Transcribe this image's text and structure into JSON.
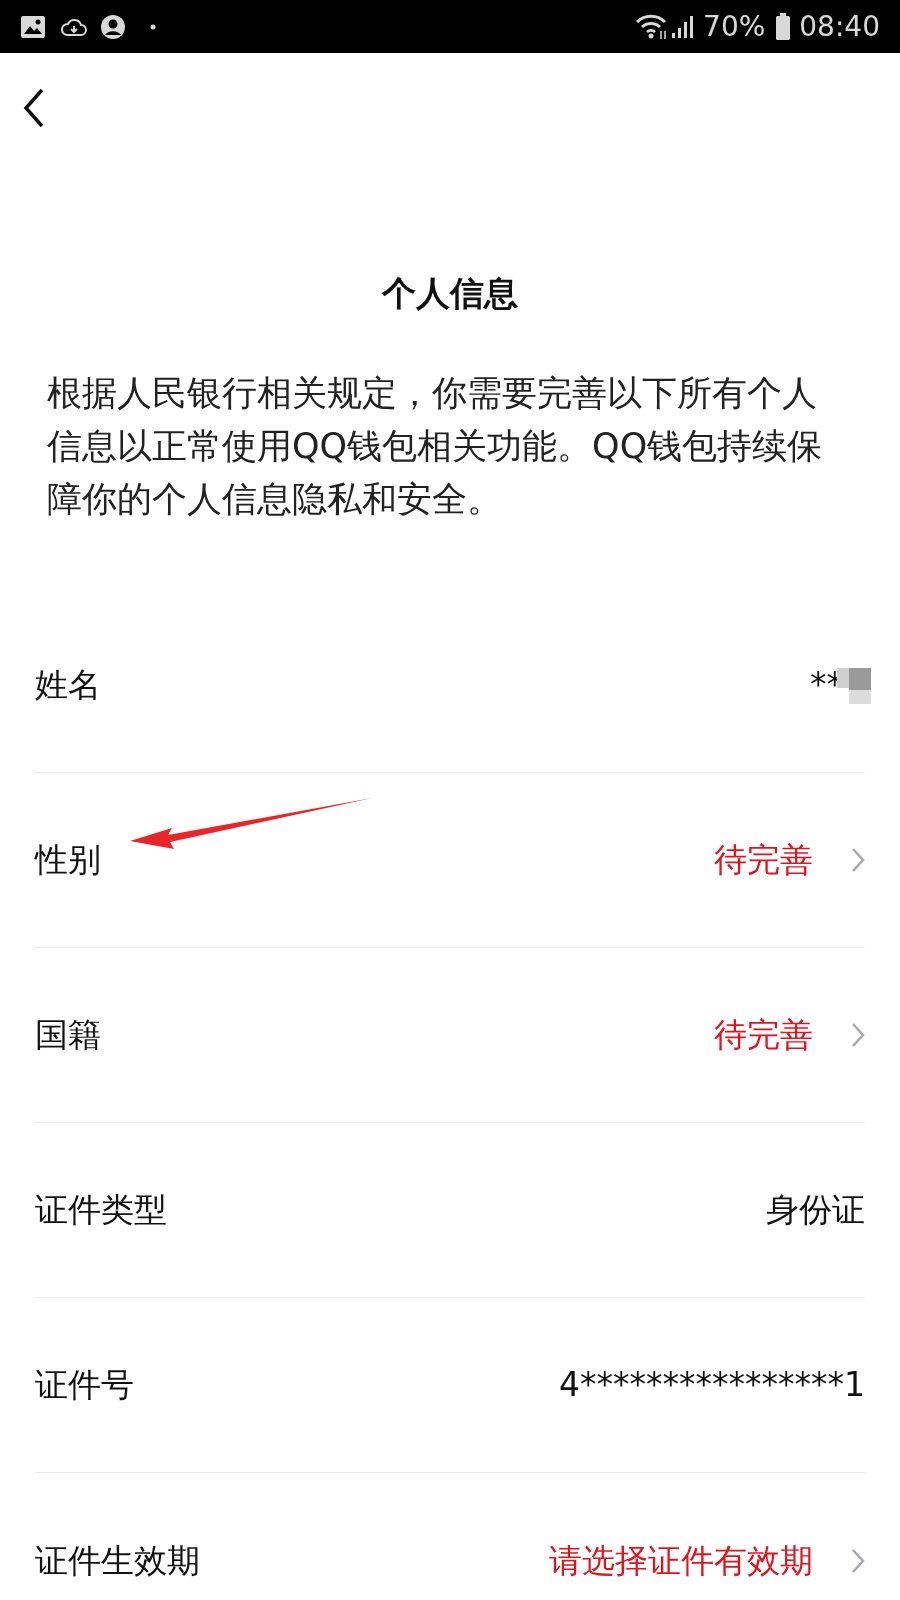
{
  "status_bar": {
    "battery": "70%",
    "time": "08:40"
  },
  "title": "个人信息",
  "description": "根据人民银行相关规定，你需要完善以下所有个人信息以正常使用QQ钱包相关功能。QQ钱包持续保障你的个人信息隐私和安全。",
  "rows": [
    {
      "label": "姓名",
      "value": "**",
      "highlight": false,
      "chevron": false,
      "redacted": true
    },
    {
      "label": "性别",
      "value": "待完善",
      "highlight": true,
      "chevron": true,
      "redacted": false
    },
    {
      "label": "国籍",
      "value": "待完善",
      "highlight": true,
      "chevron": true,
      "redacted": false
    },
    {
      "label": "证件类型",
      "value": "身份证",
      "highlight": false,
      "chevron": false,
      "redacted": false
    },
    {
      "label": "证件号",
      "value": "4****************1",
      "highlight": false,
      "chevron": false,
      "redacted": false
    },
    {
      "label": "证件生效期",
      "value": "请选择证件有效期",
      "highlight": true,
      "chevron": true,
      "redacted": false
    }
  ]
}
